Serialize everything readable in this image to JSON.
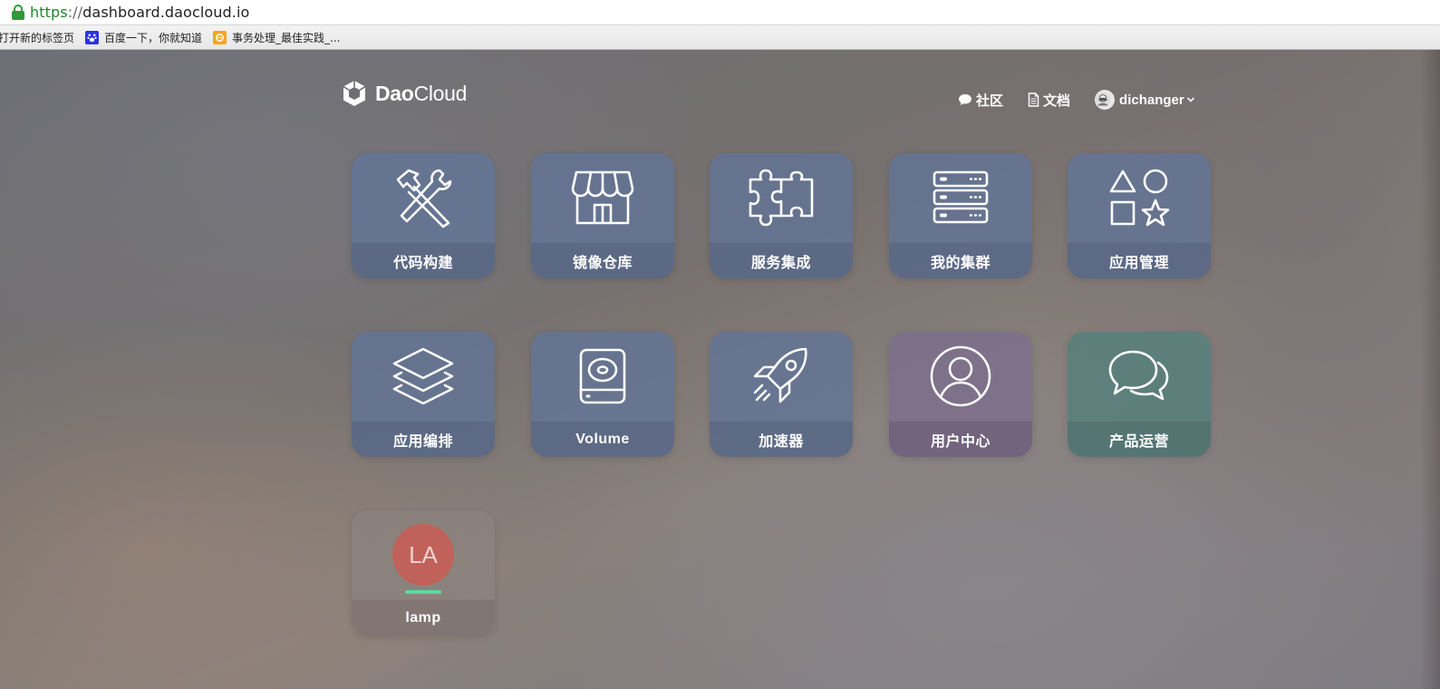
{
  "browser": {
    "url_scheme": "https",
    "url_sep": "://",
    "url_host": "dashboard.daocloud.io",
    "bookmarks": [
      {
        "label": "打开新的标签页",
        "icon": "page-icon"
      },
      {
        "label": "百度一下，你就知道",
        "icon": "baidu-paw-icon"
      },
      {
        "label": "事务处理_最佳实践_...",
        "icon": "orange-app-icon"
      }
    ]
  },
  "header": {
    "logo_dao": "Dao",
    "logo_cloud": "Cloud",
    "nav": {
      "community": "社区",
      "docs": "文档",
      "user": "dichanger"
    }
  },
  "tiles": {
    "code_build": {
      "label": "代码构建",
      "icon": "hammer-wrench-icon"
    },
    "image_repo": {
      "label": "镜像仓库",
      "icon": "store-icon"
    },
    "service_integration": {
      "label": "服务集成",
      "icon": "puzzle-icon"
    },
    "my_cluster": {
      "label": "我的集群",
      "icon": "server-stack-icon"
    },
    "app_management": {
      "label": "应用管理",
      "icon": "shapes-icon"
    },
    "app_orchestration": {
      "label": "应用编排",
      "icon": "layers-icon"
    },
    "volume": {
      "label": "Volume",
      "icon": "disk-drive-icon"
    },
    "accelerator": {
      "label": "加速器",
      "icon": "rocket-icon"
    },
    "user_center": {
      "label": "用户中心",
      "icon": "user-circle-icon"
    },
    "product_ops": {
      "label": "产品运营",
      "icon": "chat-bubbles-icon"
    },
    "lamp": {
      "label": "lamp",
      "badge": "LA",
      "badge_color": "#c0625a",
      "status_color": "#58dda0"
    }
  },
  "colors": {
    "tile_blue": "#627496",
    "tile_purple": "#7d6e8c",
    "tile_teal": "#58807c",
    "url_secure": "#1b8a29"
  }
}
